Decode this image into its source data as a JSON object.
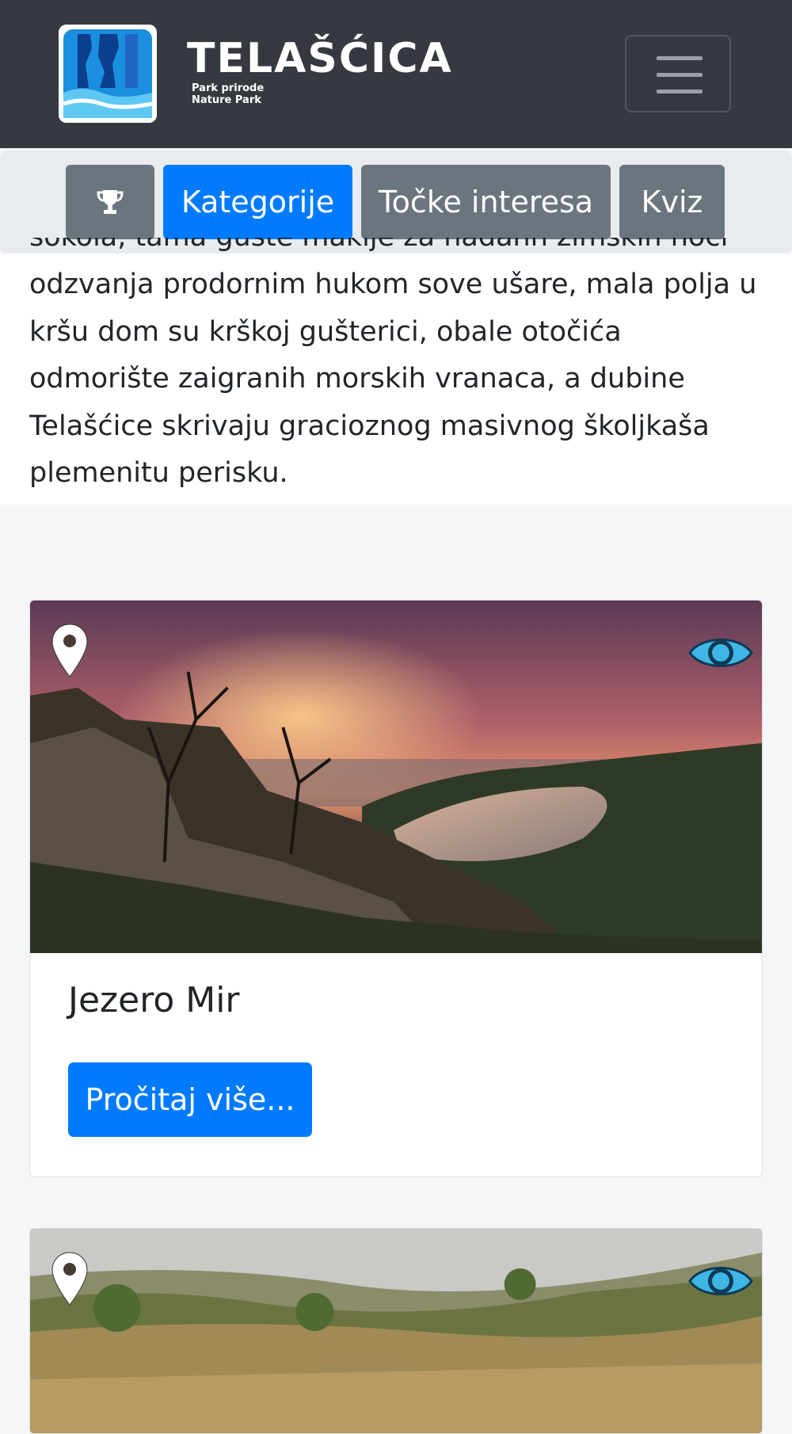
{
  "header": {
    "brand_name": "TELAŠĆICA",
    "brand_sub_line1": "Park prirode",
    "brand_sub_line2": "Nature Park"
  },
  "tabs": [
    {
      "icon": "trophy-icon"
    },
    {
      "label": "Kategorije",
      "active": true
    },
    {
      "label": "Točke interesa"
    },
    {
      "label": "Kviz"
    }
  ],
  "intro": {
    "partial_line": "sokola, tama guste makije za nadahn zimskih noći",
    "lines": [
      "odzvanja prodornim hukom sove ušare, mala polja u",
      "kršu dom su krškoj gušterici, obale otočića",
      "odmorište zaigranih morskih vranaca, a dubine",
      "Telašćice skrivaju gracioznog masivnog školjkaša",
      "plemenitu perisku."
    ]
  },
  "cards": [
    {
      "title": "Jezero Mir",
      "button_label": "Pročitaj više...",
      "pin_icon": "location-pin-icon",
      "view_icon": "eye-icon"
    },
    {
      "pin_icon": "location-pin-icon",
      "view_icon": "eye-icon"
    }
  ],
  "colors": {
    "navbar": "#343a40",
    "primary": "#007bff",
    "secondary": "#6c757d",
    "eye": "#3fb6e6"
  }
}
